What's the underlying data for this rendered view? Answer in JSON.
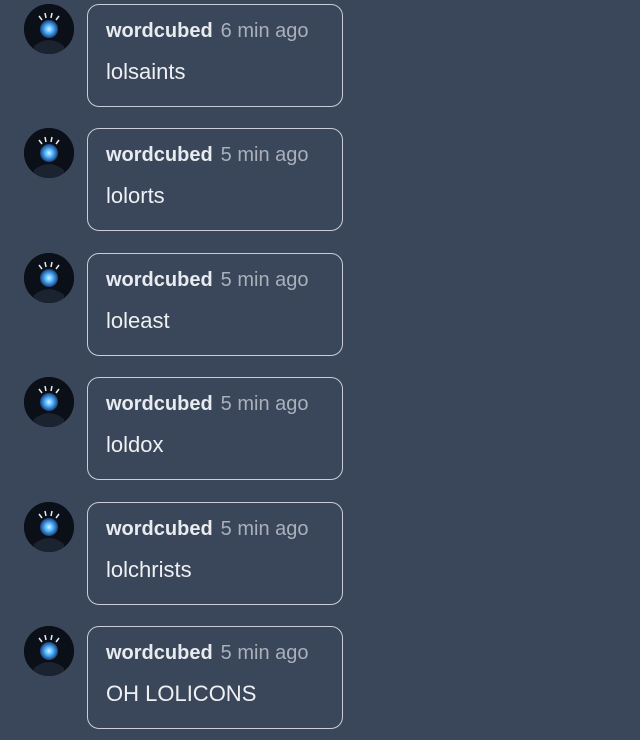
{
  "colors": {
    "background": "#3a4659",
    "bubble_border": "#c9ced6",
    "username": "#e8ebef",
    "timestamp": "#a9b0bb",
    "message": "#eef0f3",
    "avatar_glow": "#4fb4ff"
  },
  "comments": [
    {
      "username": "wordcubed",
      "timestamp": "6 min ago",
      "text": "lolsaints",
      "avatar_icon": "glowing-orb-avatar-icon"
    },
    {
      "username": "wordcubed",
      "timestamp": "5 min ago",
      "text": "lolorts",
      "avatar_icon": "glowing-orb-avatar-icon"
    },
    {
      "username": "wordcubed",
      "timestamp": "5 min ago",
      "text": "loleast",
      "avatar_icon": "glowing-orb-avatar-icon"
    },
    {
      "username": "wordcubed",
      "timestamp": "5 min ago",
      "text": "loldox",
      "avatar_icon": "glowing-orb-avatar-icon"
    },
    {
      "username": "wordcubed",
      "timestamp": "5 min ago",
      "text": "lolchrists",
      "avatar_icon": "glowing-orb-avatar-icon"
    },
    {
      "username": "wordcubed",
      "timestamp": "5 min ago",
      "text": "OH LOLICONS",
      "avatar_icon": "glowing-orb-avatar-icon"
    }
  ]
}
